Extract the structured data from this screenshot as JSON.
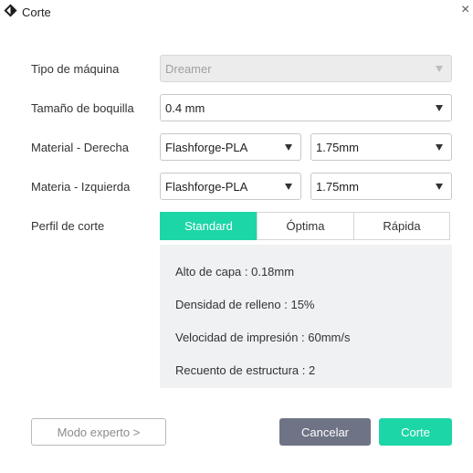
{
  "window": {
    "title": "Corte",
    "close_glyph": "×"
  },
  "icons": {
    "app": "flashforge-logo-icon",
    "close": "close-icon",
    "dropdown": "chevron-down-icon"
  },
  "form": {
    "machine": {
      "label": "Tipo de máquina",
      "value": "Dreamer",
      "disabled": true
    },
    "nozzle": {
      "label": "Tamaño de boquilla",
      "value": "0.4 mm"
    },
    "material_right": {
      "label": "Material - Derecha",
      "material": "Flashforge-PLA",
      "diameter": "1.75mm"
    },
    "material_left": {
      "label": "Materia - Izquierda",
      "material": "Flashforge-PLA",
      "diameter": "1.75mm"
    },
    "profile": {
      "label": "Perfil de corte",
      "options": [
        "Standard",
        "Óptima",
        "Rápida"
      ],
      "selected": "Standard"
    }
  },
  "profile_details": {
    "layer_height": "Alto de capa : 0.18mm",
    "infill": "Densidad de relleno : 15%",
    "speed": "Velocidad de impresión : 60mm/s",
    "shells": "Recuento de estructura : 2"
  },
  "buttons": {
    "expert": "Modo experto >",
    "cancel": "Cancelar",
    "ok": "Corte"
  },
  "colors": {
    "accent": "#1dd6a7",
    "cancel_bg": "#6e7385",
    "panel_bg": "#f0f1f3"
  }
}
